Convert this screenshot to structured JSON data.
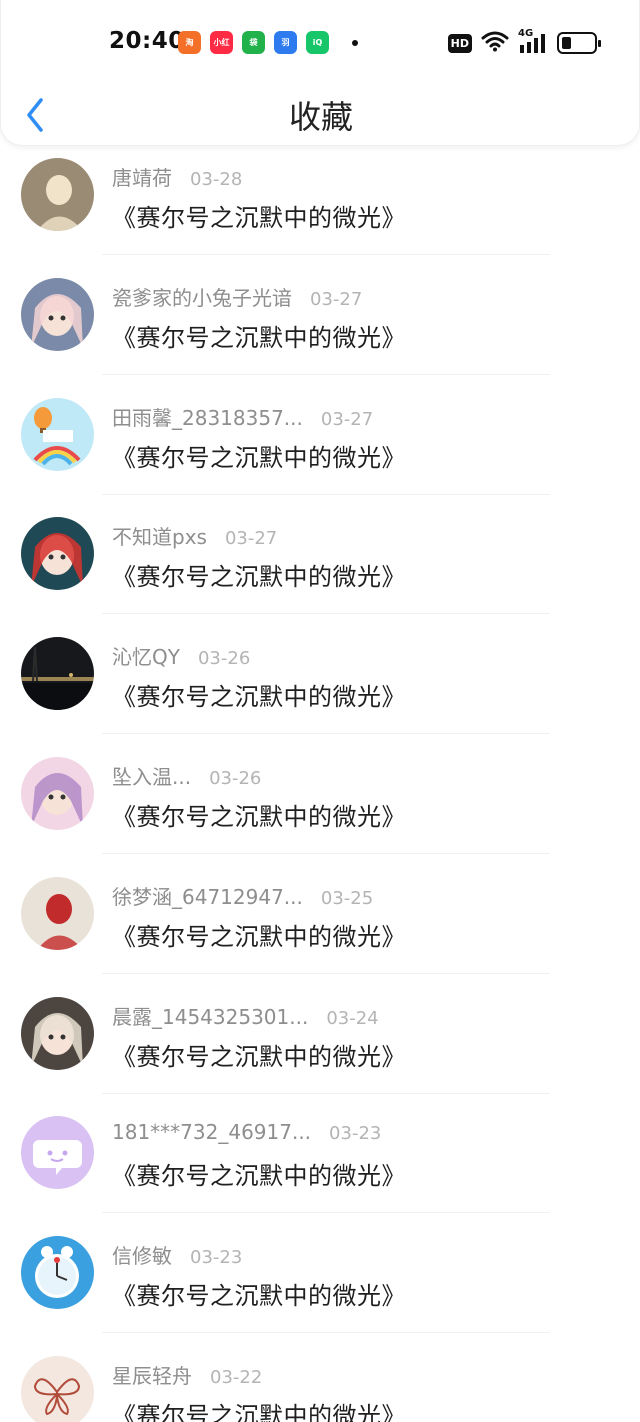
{
  "status_bar": {
    "time": "20:40",
    "apps": [
      {
        "name": "taobao-app-icon",
        "color": "#f46f27",
        "label": "淘"
      },
      {
        "name": "xiaohongshu-app-icon",
        "color": "#ff2a44",
        "label": "小红书"
      },
      {
        "name": "shopping-bag-app-icon",
        "color": "#22b24c",
        "label": "袋"
      },
      {
        "name": "feather-app-icon",
        "color": "#2e7bf0",
        "label": "羽"
      },
      {
        "name": "iqiyi-app-icon",
        "color": "#18c66a",
        "label": "iQIYI"
      }
    ],
    "hd_label": "HD",
    "network_label": "4G",
    "battery_level": 0.3
  },
  "nav": {
    "title": "收藏",
    "back_icon": "chevron-left-icon",
    "accent_color": "#2f8ef5"
  },
  "items": [
    {
      "name": "唐靖荷",
      "date": "03-28",
      "title": "《赛尔号之沉默中的微光》",
      "avatar": {
        "type": "photo",
        "bg": "#9a8b74",
        "fg": "#f0e3c9"
      }
    },
    {
      "name": "瓷爹家的小兔子光谙",
      "date": "03-27",
      "title": "《赛尔号之沉默中的微光》",
      "avatar": {
        "type": "anime",
        "bg": "#7a8aa8",
        "fg": "#f4d4d4"
      }
    },
    {
      "name": "田雨馨_28318357...",
      "date": "03-27",
      "title": "《赛尔号之沉默中的微光》",
      "avatar": {
        "type": "rainbow",
        "bg": "#bfe9f6",
        "fg": "#f59a3a"
      }
    },
    {
      "name": "不知道pxs",
      "date": "03-27",
      "title": "《赛尔号之沉默中的微光》",
      "avatar": {
        "type": "anime",
        "bg": "#1f4a55",
        "fg": "#d8322e"
      }
    },
    {
      "name": "沁忆QY",
      "date": "03-26",
      "title": "《赛尔号之沉默中的微光》",
      "avatar": {
        "type": "night",
        "bg": "#16181b",
        "fg": "#d6b46c"
      }
    },
    {
      "name": "坠入温...",
      "date": "03-26",
      "title": "《赛尔号之沉默中的微光》",
      "avatar": {
        "type": "anime",
        "bg": "#f3d6e5",
        "fg": "#b08ac8"
      }
    },
    {
      "name": "徐梦涵_64712947...",
      "date": "03-25",
      "title": "《赛尔号之沉默中的微光》",
      "avatar": {
        "type": "photo",
        "bg": "#e9e2d8",
        "fg": "#c22b2b"
      }
    },
    {
      "name": "晨露_1454325301...",
      "date": "03-24",
      "title": "《赛尔号之沉默中的微光》",
      "avatar": {
        "type": "anime",
        "bg": "#4d4540",
        "fg": "#e9dfd2"
      }
    },
    {
      "name": "181***732_46917...",
      "date": "03-23",
      "title": "《赛尔号之沉默中的微光》",
      "avatar": {
        "type": "chat",
        "bg": "#d9c2f3",
        "fg": "#ffffff"
      }
    },
    {
      "name": "信修敏",
      "date": "03-23",
      "title": "《赛尔号之沉默中的微光》",
      "avatar": {
        "type": "clock",
        "bg": "#3aa0df",
        "fg": "#ffffff"
      }
    },
    {
      "name": "星辰轻舟",
      "date": "03-22",
      "title": "《赛尔号之沉默中的微光》",
      "avatar": {
        "type": "butterfly",
        "bg": "#f3e7e0",
        "fg": "#b14b3a"
      }
    }
  ]
}
